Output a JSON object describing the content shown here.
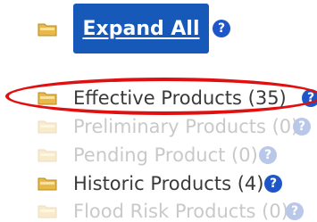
{
  "expand": {
    "label": "Expand All",
    "help": "?"
  },
  "items": [
    {
      "label": "Effective Products (35)",
      "help": "?",
      "state": "active"
    },
    {
      "label": "Preliminary Products (0)",
      "help": "?",
      "state": "faded"
    },
    {
      "label": "Pending Product (0)",
      "help": "?",
      "state": "faded"
    },
    {
      "label": "Historic Products (4)",
      "help": "?",
      "state": "active"
    },
    {
      "label": "Flood Risk Products (0)",
      "help": "?",
      "state": "faded"
    }
  ],
  "colors": {
    "button": "#1659b8",
    "help_icon": "#1e56c8",
    "folder": "#e8b94a",
    "highlight": "#e01010"
  }
}
